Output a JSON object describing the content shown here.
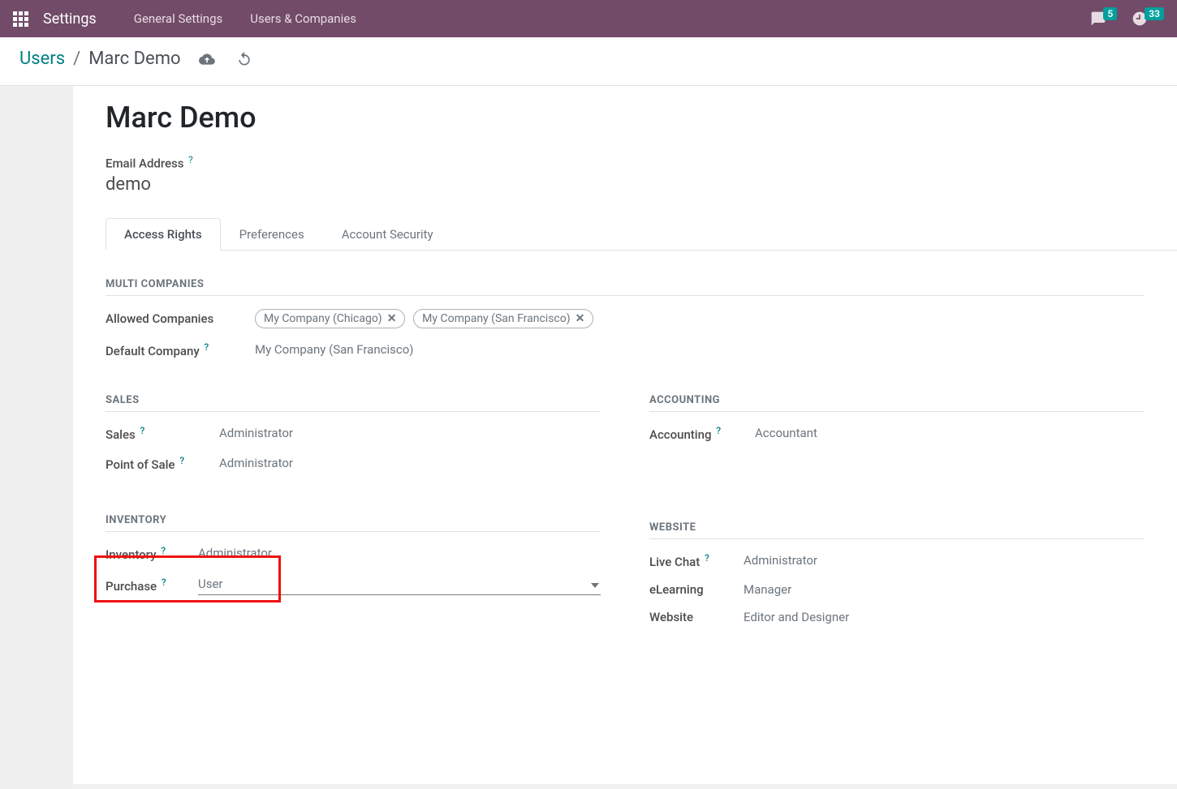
{
  "topbar": {
    "app_title": "Settings",
    "links": [
      "General Settings",
      "Users & Companies"
    ],
    "msg_count": "5",
    "clock_count": "33"
  },
  "breadcrumb": {
    "parent": "Users",
    "current": "Marc Demo"
  },
  "page": {
    "title": "Marc Demo",
    "email_label": "Email Address",
    "email_value": "demo"
  },
  "tabs": [
    "Access Rights",
    "Preferences",
    "Account Security"
  ],
  "sections": {
    "multi_companies": "MULTI COMPANIES",
    "sales": "SALES",
    "accounting": "ACCOUNTING",
    "inventory": "INVENTORY",
    "website": "WEBSITE"
  },
  "multi": {
    "allowed_label": "Allowed Companies",
    "allowed_tags": [
      "My Company (Chicago)",
      "My Company (San Francisco)"
    ],
    "default_label": "Default Company",
    "default_value": "My Company (San Francisco)"
  },
  "fields": {
    "sales": {
      "label": "Sales",
      "value": "Administrator"
    },
    "pos": {
      "label": "Point of Sale",
      "value": "Administrator"
    },
    "accounting": {
      "label": "Accounting",
      "value": "Accountant"
    },
    "inventory": {
      "label": "Inventory",
      "value": "Administrator"
    },
    "purchase": {
      "label": "Purchase",
      "value": "User"
    },
    "livechat": {
      "label": "Live Chat",
      "value": "Administrator"
    },
    "elearning": {
      "label": "eLearning",
      "value": "Manager"
    },
    "websitef": {
      "label": "Website",
      "value": "Editor and Designer"
    }
  }
}
